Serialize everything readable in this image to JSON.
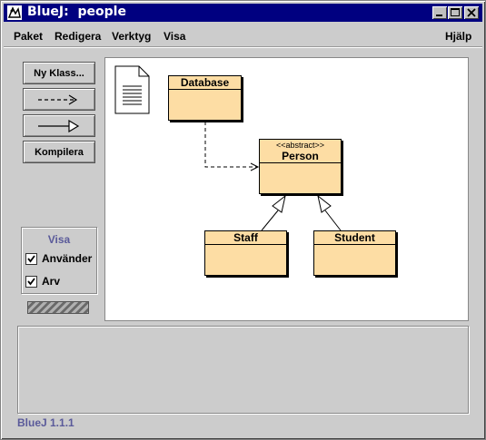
{
  "window": {
    "title": "BlueJ:  people"
  },
  "menubar": {
    "items": [
      {
        "label": "Paket"
      },
      {
        "label": "Redigera"
      },
      {
        "label": "Verktyg"
      },
      {
        "label": "Visa"
      }
    ],
    "help": {
      "label": "Hjälp"
    }
  },
  "toolbar": {
    "new_class_label": "Ny Klass...",
    "compile_label": "Kompilera"
  },
  "view_panel": {
    "title": "Visa",
    "uses": {
      "label": "Använder",
      "checked": true
    },
    "inheritance": {
      "label": "Arv",
      "checked": true
    }
  },
  "diagram": {
    "classes": [
      {
        "name": "Database",
        "stereotype": ""
      },
      {
        "name": "Person",
        "stereotype": "<<abstract>>"
      },
      {
        "name": "Staff",
        "stereotype": ""
      },
      {
        "name": "Student",
        "stereotype": ""
      }
    ]
  },
  "status_bar": {
    "text": "BlueJ 1.1.1"
  },
  "colors": {
    "class_fill": "#fddda4",
    "title_bar": "#000080",
    "status_text": "#5a5a9a"
  }
}
